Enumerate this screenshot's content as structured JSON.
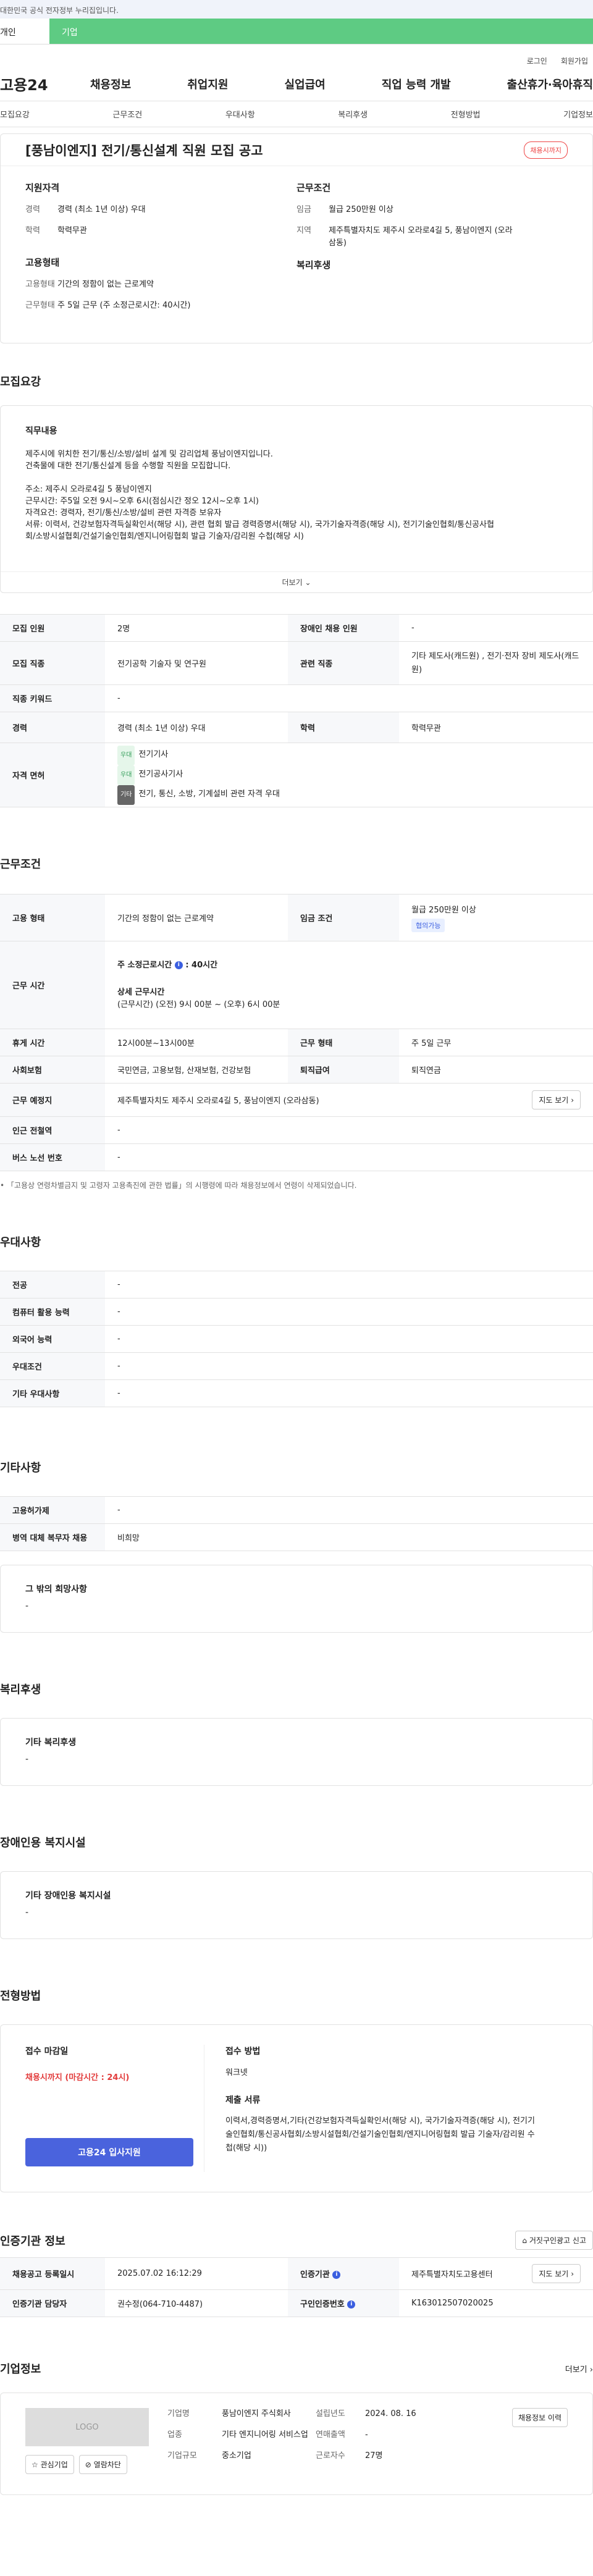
{
  "gov_notice": "대한민국 공식 전자정부 누리집입니다.",
  "site_tabs": [
    "개인",
    "기업"
  ],
  "util_links": [
    "로그인",
    "회원가입"
  ],
  "logo": "고용24",
  "gnb": [
    "채용정보",
    "취업지원",
    "실업급여",
    "직업 능력 개발",
    "출산휴가·육아휴직"
  ],
  "anchor_tabs": [
    "모집요강",
    "근무조건",
    "우대사항",
    "복리후생",
    "전형방법",
    "기업정보"
  ],
  "job": {
    "title": "[풍남이엔지] 전기/통신설계 직원 모집 공고",
    "status": "채용시까지",
    "qual_heading": "지원자격",
    "cond_heading": "근무조건",
    "emp_heading": "고용형태",
    "benefit_heading": "복리후생",
    "career_k": "경력",
    "career_v": "경력 (최소 1년 이상) 우대",
    "edu_k": "학력",
    "edu_v": "학력무관",
    "wage_k": "임금",
    "wage_v": "월급 250만원 이상",
    "area_k": "지역",
    "area_v": "제주특별자치도 제주시 오라로4길 5, 풍남이엔지 (오라삼동)",
    "emptype_k": "고용형태",
    "emptype_v": "기간의 정함이 없는 근로계약",
    "worktype_k": "근무형태",
    "worktype_v": "주 5일 근무 (주 소정근로시간: 40시간)"
  },
  "recruit": {
    "heading": "모집요강",
    "detail_heading": "직무내용",
    "detail_lines": [
      "제주시에 위치한 전기/통신/소방/설비 설계 및 감리업체 풍남이엔지입니다.",
      "건축물에 대한 전기/통신설계 등을 수행할 직원을 모집합니다.",
      "",
      "주소: 제주시 오라로4길 5 풍남이엔지",
      "근무시간: 주5일 오전 9시~오후 6시(점심시간 정오 12시~오후 1시)",
      "자격요건: 경력자, 전기/통신/소방/설비 관련 자격증 보유자",
      "서류: 이력서, 건강보험자격득실확인서(해당 시), 관련 협회 발급 경력증명서(해당 시), 국가기술자격증(해당 시), 전기기술인협회/통신공사협",
      "회/소방시설협회/건설기술인협회/엔지니어링협회 발급 기술자/감리원 수첩(해당 시)"
    ],
    "more": "더보기",
    "count_k": "모집 인원",
    "count_v": "2명",
    "disabled_k": "장애인 채용 인원",
    "disabled_v": "-",
    "job_k": "모집 직종",
    "job_v": "전기공학 기술자 및 연구원",
    "rel_k": "관련 직종",
    "rel_v": "기타 제도사(캐드원) , 전기·전자 장비 제도사(캐드원)",
    "code_k": "직종 키워드",
    "code_v": "-",
    "career_k": "경력",
    "career_v": "경력 (최소 1년 이상) 우대",
    "edu_k": "학력",
    "edu_v": "학력무관",
    "license_k": "자격 면허",
    "licenses": [
      {
        "tag": "우대",
        "name": "전기기사"
      },
      {
        "tag": "우대",
        "name": "전기공사기사"
      },
      {
        "tag": "기타",
        "name": "전기, 통신, 소방, 기계설비 관련 자격 우대"
      }
    ]
  },
  "conditions": {
    "heading": "근무조건",
    "emp_k": "고용 형태",
    "emp_v": "기간의 정함이 없는 근로계약",
    "wage_k": "임금 조건",
    "wage_v": "월급 250만원 이상",
    "wage_chip": "협의가능",
    "hours_k": "근무 시간",
    "hours_main": "주 소정근로시간",
    "hours_main_v": ": 40시간",
    "hours_detail_h": "상세 근무시간",
    "hours_detail_v": "(근무시간) (오전) 9시 00분 ~ (오후) 6시 00분",
    "break_k": "휴게 시간",
    "break_v": "12시00분~13시00분",
    "worktype_k": "근무 형태",
    "worktype_v": "주 5일 근무",
    "insurance_k": "사회보험",
    "insurance_v": "국민연금, 고용보험, 산재보험, 건강보험",
    "retire_k": "퇴직급여",
    "retire_v": "퇴직연금",
    "place_k": "근무 예정지",
    "place_v": "제주특별자치도 제주시 오라로4길 5, 풍남이엔지 (오라삼동)",
    "map_btn": "지도 보기",
    "station_k": "인근 전철역",
    "station_v": "-",
    "bus_k": "버스 노선 번호",
    "bus_v": "-",
    "note": "「고용상 연령차별금지 및 고령자 고용촉진에 관한 법률」의 시행령에 따라 채용정보에서 연령이 삭제되었습니다."
  },
  "preference": {
    "heading": "우대사항",
    "rows": [
      {
        "k": "전공",
        "v": "-"
      },
      {
        "k": "컴퓨터 활용 능력",
        "v": "-"
      },
      {
        "k": "외국어 능력",
        "v": "-"
      },
      {
        "k": "우대조건",
        "v": "-"
      },
      {
        "k": "기타 우대사항",
        "v": "-"
      }
    ]
  },
  "etc": {
    "heading": "기타사항",
    "emp_k": "고용허가제",
    "emp_v": "-",
    "army_k": "병역 대체 복무자 채용",
    "army_v": "비희망",
    "other_h": "그 밖의 희망사항",
    "other_v": "-"
  },
  "welfare": {
    "heading": "복리후생",
    "h": "기타 복리후생",
    "v": "-"
  },
  "disabled_fac": {
    "heading": "장애인용 복지시설",
    "h": "기타 장애인용 복지시설",
    "v": "-"
  },
  "selection": {
    "heading": "전형방법",
    "deadline_h": "접수 마감일",
    "deadline_v": "채용시까지 (마감시간 : 24시)",
    "apply_btn": "고용24 입사지원",
    "method_h": "접수 방법",
    "method_v": "워크넷",
    "docs_h": "제출 서류",
    "docs_v": "이력서,경력증명서,기타(건강보험자격득실확인서(해당 시), 국가기술자격증(해당 시), 전기기술인협회/통신공사협회/소방시설협회/건설기술인협회/엔지니어링협회 발급 기술자/감리원 수첩(해당 시))"
  },
  "cert": {
    "heading": "인증기관 정보",
    "report_btn": "거짓구인광고 신고",
    "reg_k": "채용공고 등록일시",
    "reg_v": "2025.07.02 16:12:29",
    "org_k": "인증기관",
    "org_v": "제주특별자치도고용센터",
    "map_btn": "지도 보기",
    "manager_k": "인증기관 담당자",
    "manager_v": "권수정(064-710-4487)",
    "no_k": "구인인증번호",
    "no_v": "K163012507020025"
  },
  "company": {
    "heading": "기업정보",
    "more": "더보기",
    "logo": "LOGO",
    "fav_btn": "관심기업",
    "block_btn": "열람차단",
    "name_k": "기업명",
    "name_v": "풍남이엔지 주식회사",
    "ind_k": "업종",
    "ind_v": "기타 엔지니어링 서비스업",
    "size_k": "기업규모",
    "size_v": "중소기업",
    "est_k": "설립년도",
    "est_v": "2024. 08. 16",
    "sales_k": "연매출액",
    "sales_v": "-",
    "emp_k": "근로자수",
    "emp_v": "27명",
    "hire_btn": "채용정보 이력"
  }
}
